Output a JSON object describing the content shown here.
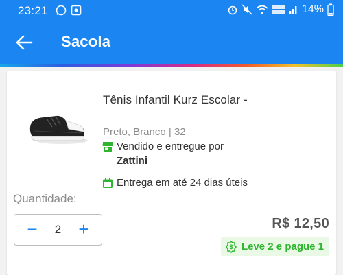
{
  "status_bar": {
    "time": "23:21",
    "icons_left": [
      "whatsapp-icon",
      "gallery-icon"
    ],
    "icons_right": [
      "alarm-icon",
      "mute-icon",
      "wifi-icon",
      "volte-icon",
      "signal-icon"
    ],
    "battery_text": "14%"
  },
  "header": {
    "title": "Sacola",
    "back_icon": "arrow-left-icon"
  },
  "product": {
    "name": "Tênis Infantil Kurz Escolar -",
    "variant": "Preto, Branco | 32",
    "sold_by_label": "Vendido e entregue por",
    "seller": "Zattini",
    "delivery": "Entrega em até 24 dias úteis",
    "image_icon": "sneaker-image"
  },
  "quantity": {
    "label": "Quantidade:",
    "value": "2",
    "minus": "−",
    "plus": "+"
  },
  "price": "R$ 12,50",
  "promo": {
    "text": "Leve 2 e pague 1"
  },
  "colors": {
    "primary": "#1b86f2",
    "promo_green": "#2fb52f",
    "promo_bg": "#e9f9e5"
  }
}
